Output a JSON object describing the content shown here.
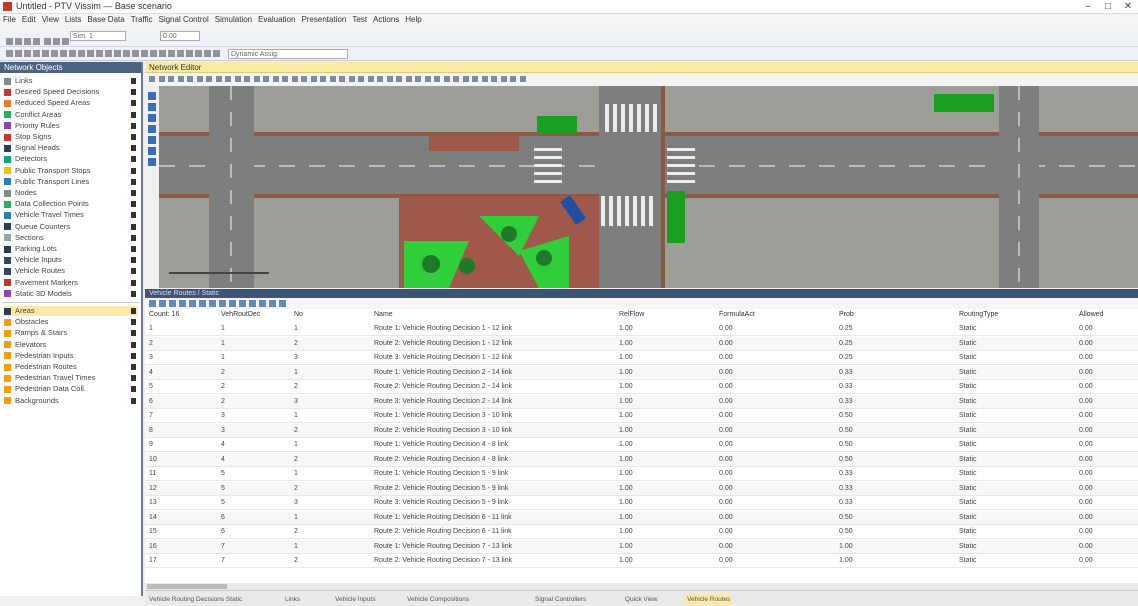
{
  "window": {
    "title": "Untitled - PTV Vissim — Base scenario",
    "controls": [
      "–",
      "□",
      "✕"
    ]
  },
  "menu": [
    "File",
    "Edit",
    "View",
    "Lists",
    "Base Data",
    "Traffic",
    "Signal Control",
    "Simulation",
    "Evaluation",
    "Presentation",
    "Test",
    "Actions",
    "Help"
  ],
  "toolbar": {
    "sim_field": "Sim. 1",
    "time_field": "0.00",
    "select_value": "Dynamic Assig."
  },
  "left_panel": {
    "header": "Network Objects",
    "items": [
      {
        "label": "Links",
        "icon_color": "#7f8c8d"
      },
      {
        "label": "Desired Speed Decisions",
        "icon_color": "#c0392b"
      },
      {
        "label": "Reduced Speed Areas",
        "icon_color": "#e67e22"
      },
      {
        "label": "Conflict Areas",
        "icon_color": "#27ae60"
      },
      {
        "label": "Priority Rules",
        "icon_color": "#8e44ad"
      },
      {
        "label": "Stop Signs",
        "icon_color": "#c0392b"
      },
      {
        "label": "Signal Heads",
        "icon_color": "#2c3e50"
      },
      {
        "label": "Detectors",
        "icon_color": "#16a085"
      },
      {
        "label": "Public Transport Stops",
        "icon_color": "#f1c40f"
      },
      {
        "label": "Public Transport Lines",
        "icon_color": "#2980b9"
      },
      {
        "label": "Nodes",
        "icon_color": "#7f8c8d"
      },
      {
        "label": "Data Collection Points",
        "icon_color": "#27ae60"
      },
      {
        "label": "Vehicle Travel Times",
        "icon_color": "#2980b9"
      },
      {
        "label": "Queue Counters",
        "icon_color": "#2c3e50"
      },
      {
        "label": "Sections",
        "icon_color": "#95a5a6"
      },
      {
        "label": "Parking Lots",
        "icon_color": "#2c3e50"
      },
      {
        "label": "Vehicle Inputs",
        "icon_color": "#34495e"
      },
      {
        "label": "Vehicle Routes",
        "icon_color": "#34495e"
      },
      {
        "label": "Pavement Markers",
        "icon_color": "#c0392b"
      },
      {
        "label": "Static 3D Models",
        "icon_color": "#8e44ad"
      },
      {
        "label": "Areas",
        "icon_color": "#2c3e50"
      },
      {
        "label": "Obstacles",
        "icon_color": "#f39c12"
      },
      {
        "label": "Ramps & Stairs",
        "icon_color": "#f39c12"
      },
      {
        "label": "Elevators",
        "icon_color": "#f39c12"
      },
      {
        "label": "Pedestrian Inputs",
        "icon_color": "#f39c12"
      },
      {
        "label": "Pedestrian Routes",
        "icon_color": "#f39c12"
      },
      {
        "label": "Pedestrian Travel Times",
        "icon_color": "#f39c12"
      },
      {
        "label": "Pedestrian Data Coll.",
        "icon_color": "#f39c12"
      },
      {
        "label": "Backgrounds",
        "icon_color": "#f39c12"
      }
    ],
    "selected_index": 20
  },
  "network_editor": {
    "header": "Network Editor"
  },
  "list": {
    "header": "Vehicle Routes / Static",
    "columns": [
      "Count: 16",
      "VehRoutDec",
      "No",
      "Name",
      "RelFlow",
      "FormulaAct",
      "Prob",
      "RoutingType",
      "Allowed"
    ],
    "rows": [
      [
        "1",
        "1",
        "1",
        "Route 1: Vehicle Routing Decision 1 - 12 link",
        "1.00",
        "0.00",
        "0.25",
        "Static",
        "0.00"
      ],
      [
        "2",
        "1",
        "2",
        "Route 2: Vehicle Routing Decision 1 - 12 link",
        "1.00",
        "0.00",
        "0.25",
        "Static",
        "0.00"
      ],
      [
        "3",
        "1",
        "3",
        "Route 3: Vehicle Routing Decision 1 - 12 link",
        "1.00",
        "0.00",
        "0.25",
        "Static",
        "0.00"
      ],
      [
        "4",
        "2",
        "1",
        "Route 1: Vehicle Routing Decision 2 - 14 link",
        "1.00",
        "0.00",
        "0.33",
        "Static",
        "0.00"
      ],
      [
        "5",
        "2",
        "2",
        "Route 2: Vehicle Routing Decision 2 - 14 link",
        "1.00",
        "0.00",
        "0.33",
        "Static",
        "0.00"
      ],
      [
        "6",
        "2",
        "3",
        "Route 3: Vehicle Routing Decision 2 - 14 link",
        "1.00",
        "0.00",
        "0.33",
        "Static",
        "0.00"
      ],
      [
        "7",
        "3",
        "1",
        "Route 1: Vehicle Routing Decision 3 - 10 link",
        "1.00",
        "0.00",
        "0.50",
        "Static",
        "0.00"
      ],
      [
        "8",
        "3",
        "2",
        "Route 2: Vehicle Routing Decision 3 - 10 link",
        "1.00",
        "0.00",
        "0.50",
        "Static",
        "0.00"
      ],
      [
        "9",
        "4",
        "1",
        "Route 1: Vehicle Routing Decision 4 - 8 link",
        "1.00",
        "0.00",
        "0.50",
        "Static",
        "0.00"
      ],
      [
        "10",
        "4",
        "2",
        "Route 2: Vehicle Routing Decision 4 - 8 link",
        "1.00",
        "0.00",
        "0.50",
        "Static",
        "0.00"
      ],
      [
        "11",
        "5",
        "1",
        "Route 1: Vehicle Routing Decision 5 - 9 link",
        "1.00",
        "0.00",
        "0.33",
        "Static",
        "0.00"
      ],
      [
        "12",
        "5",
        "2",
        "Route 2: Vehicle Routing Decision 5 - 9 link",
        "1.00",
        "0.00",
        "0.33",
        "Static",
        "0.00"
      ],
      [
        "13",
        "5",
        "3",
        "Route 3: Vehicle Routing Decision 5 - 9 link",
        "1.00",
        "0.00",
        "0.33",
        "Static",
        "0.00"
      ],
      [
        "14",
        "6",
        "1",
        "Route 1: Vehicle Routing Decision 6 - 11 link",
        "1.00",
        "0.00",
        "0.50",
        "Static",
        "0.00"
      ],
      [
        "15",
        "6",
        "2",
        "Route 2: Vehicle Routing Decision 6 - 11 link",
        "1.00",
        "0.00",
        "0.50",
        "Static",
        "0.00"
      ],
      [
        "16",
        "7",
        "1",
        "Route 1: Vehicle Routing Decision 7 - 13 link",
        "1.00",
        "0.00",
        "1.00",
        "Static",
        "0.00"
      ],
      [
        "17",
        "7",
        "2",
        "Route 2: Vehicle Routing Decision 7 - 13 link",
        "1.00",
        "0.00",
        "1.00",
        "Static",
        "0.00"
      ]
    ]
  },
  "bottom_tabs": [
    {
      "label": "Vehicle Routing Decisions Static",
      "active": false
    },
    {
      "label": "Links",
      "active": false
    },
    {
      "label": "Vehicle Inputs",
      "active": false
    },
    {
      "label": "Vehicle Compositions",
      "active": false
    },
    {
      "label": "Signal Controllers",
      "active": false
    },
    {
      "label": "Quick View",
      "active": false
    },
    {
      "label": "Vehicle Routes",
      "active": true
    }
  ]
}
